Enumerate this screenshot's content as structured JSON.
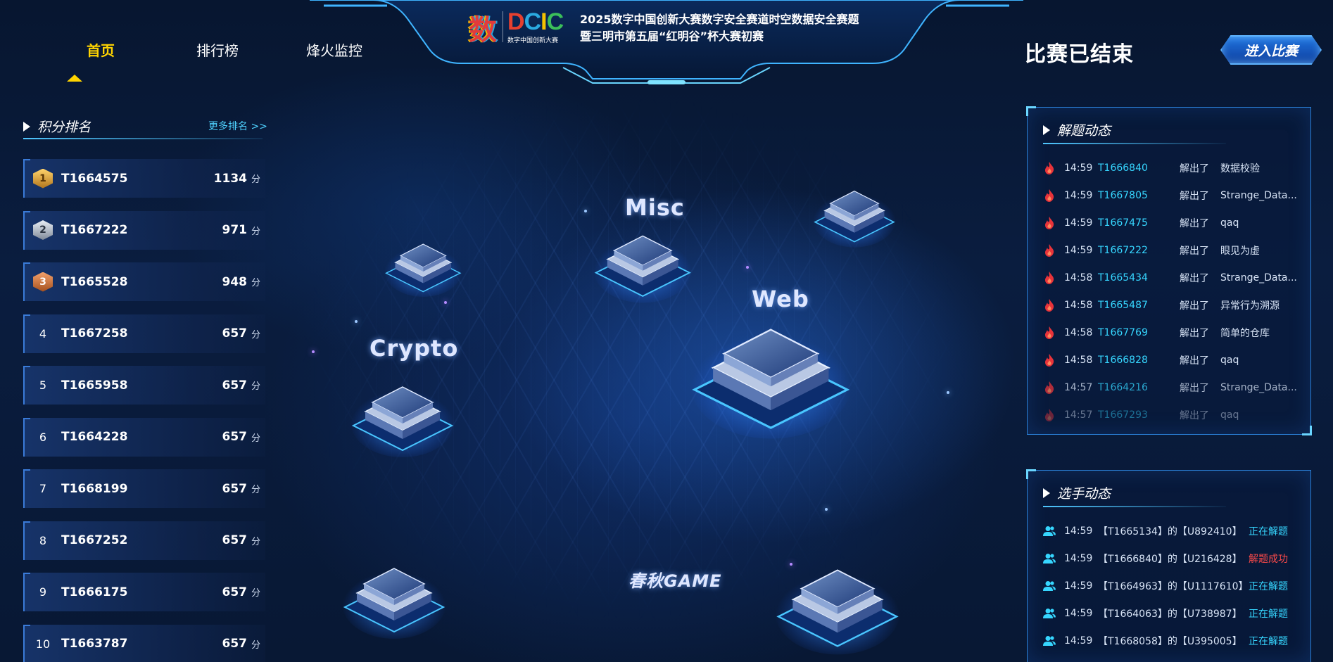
{
  "header": {
    "title_line1": "2025数字中国创新大赛数字安全赛道时空数据安全赛题",
    "title_line2": "暨三明市第五届“红明谷”杯大赛初赛",
    "logo_text": "DCIC",
    "logo_subtext": "数字中国创新大赛"
  },
  "nav": {
    "items": [
      {
        "label": "首页",
        "active": true
      },
      {
        "label": "排行榜",
        "active": false
      },
      {
        "label": "烽火监控",
        "active": false
      }
    ]
  },
  "contest_status": "比赛已结束",
  "enter_button": "进入比赛",
  "ranking": {
    "title": "积分排名",
    "more_link": "更多排名 >>",
    "unit": "分",
    "rows": [
      {
        "rank": "1",
        "team": "T1664575",
        "score": "1134",
        "medal": "gold"
      },
      {
        "rank": "2",
        "team": "T1667222",
        "score": "971",
        "medal": "silver"
      },
      {
        "rank": "3",
        "team": "T1665528",
        "score": "948",
        "medal": "bronze"
      },
      {
        "rank": "4",
        "team": "T1667258",
        "score": "657",
        "medal": ""
      },
      {
        "rank": "5",
        "team": "T1665958",
        "score": "657",
        "medal": ""
      },
      {
        "rank": "6",
        "team": "T1664228",
        "score": "657",
        "medal": ""
      },
      {
        "rank": "7",
        "team": "T1668199",
        "score": "657",
        "medal": ""
      },
      {
        "rank": "8",
        "team": "T1667252",
        "score": "657",
        "medal": ""
      },
      {
        "rank": "9",
        "team": "T1666175",
        "score": "657",
        "medal": ""
      },
      {
        "rank": "10",
        "team": "T1663787",
        "score": "657",
        "medal": ""
      }
    ]
  },
  "categories": {
    "misc": "Misc",
    "web": "Web",
    "crypto": "Crypto",
    "game": "春秋GAME"
  },
  "solve_feed": {
    "title": "解题动态",
    "rows": [
      {
        "time": "14:59",
        "team": "T1666840",
        "verb": "解出了",
        "challenge": "数据校验"
      },
      {
        "time": "14:59",
        "team": "T1667805",
        "verb": "解出了",
        "challenge": "Strange_Data..."
      },
      {
        "time": "14:59",
        "team": "T1667475",
        "verb": "解出了",
        "challenge": "qaq"
      },
      {
        "time": "14:59",
        "team": "T1667222",
        "verb": "解出了",
        "challenge": "眼见为虚"
      },
      {
        "time": "14:58",
        "team": "T1665434",
        "verb": "解出了",
        "challenge": "Strange_Data..."
      },
      {
        "time": "14:58",
        "team": "T1665487",
        "verb": "解出了",
        "challenge": "异常行为溯源"
      },
      {
        "time": "14:58",
        "team": "T1667769",
        "verb": "解出了",
        "challenge": "简单的仓库"
      },
      {
        "time": "14:58",
        "team": "T1666828",
        "verb": "解出了",
        "challenge": "qaq"
      },
      {
        "time": "14:57",
        "team": "T1664216",
        "verb": "解出了",
        "challenge": "Strange_Data..."
      },
      {
        "time": "14:57",
        "team": "T1667293",
        "verb": "解出了",
        "challenge": "qaq"
      }
    ]
  },
  "player_feed": {
    "title": "选手动态",
    "rows": [
      {
        "time": "14:59",
        "desc": "【T1665134】的【U892410】",
        "status": "正在解题",
        "success": false
      },
      {
        "time": "14:59",
        "desc": "【T1666840】的【U216428】",
        "status": "解题成功",
        "success": true
      },
      {
        "time": "14:59",
        "desc": "【T1664963】的【U1117610】",
        "status": "正在解题",
        "success": false
      },
      {
        "time": "14:59",
        "desc": "【T1664063】的【U738987】",
        "status": "正在解题",
        "success": false
      },
      {
        "time": "14:59",
        "desc": "【T1668058】的【U395005】",
        "status": "正在解题",
        "success": false
      }
    ]
  },
  "colors": {
    "accent_yellow": "#ffd400",
    "team_cyan": "#36d6ff",
    "success_red": "#ff4a4a",
    "panel_border": "#2a7fd6"
  }
}
